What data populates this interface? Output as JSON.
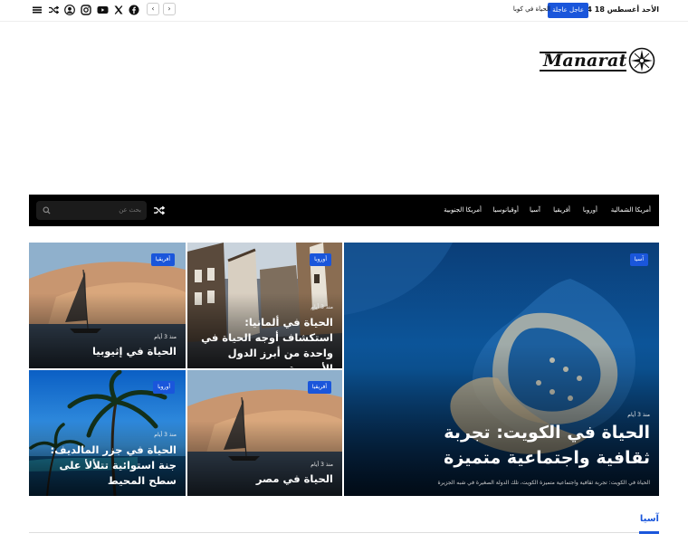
{
  "topbar": {
    "date": "الأحد أغسطس 18 2024",
    "badge": "عاجل عاجلة",
    "ticker": "الحياة في كوبا",
    "prev_icon": "chevron-left-icon",
    "next_icon": "chevron-right-icon",
    "social_icons": [
      "facebook-icon",
      "youtube-icon",
      "x-icon",
      "instagram-icon",
      "user-icon",
      "shuffle-icon",
      "menu-icon"
    ]
  },
  "logo": {
    "text": "Manarat",
    "icon": "compass-icon"
  },
  "nav": {
    "items": [
      "أمريكا الشمالية",
      "أوروبا",
      "أفريقيا",
      "آسيا",
      "أوقيانوسيا",
      "أمريكا الجنوبية"
    ],
    "search_placeholder": "بحث عن",
    "shuffle_icon": "shuffle-icon",
    "search_icon": "search-icon"
  },
  "cards": {
    "main": {
      "category": "آسيا",
      "meta": "منذ 3 أيام",
      "title": "الحياة في الكويت: تجربة ثقافية واجتماعية متميزة",
      "excerpt": "الحياة في الكويت: تجربة ثقافية واجتماعية متميزة الكويت، تلك الدولة الصغيرة في شبه الجزيرة"
    },
    "germany": {
      "category": "أوروبا",
      "meta": "منذ 3 أيام",
      "title": "الحياة في ألمانيا: استكشاف أوجه الحياة في واحدة من أبرز الدول الأوروبية"
    },
    "ethiopia": {
      "category": "أفريقيا",
      "meta": "منذ 3 أيام",
      "title": "الحياة في إثيوبيا"
    },
    "egypt": {
      "category": "أفريقيا",
      "meta": "منذ 3 أيام",
      "title": "الحياة في مصر"
    },
    "maldives": {
      "category": "أوروبا",
      "meta": "منذ 3 أيام",
      "title": "الحياة في جزر المالديف: جنة استوائية تتلألأ على سطح المحيط"
    }
  },
  "section": {
    "title": "آسيا"
  },
  "colors": {
    "accent": "#1a56db",
    "nav_bg": "#000000"
  }
}
